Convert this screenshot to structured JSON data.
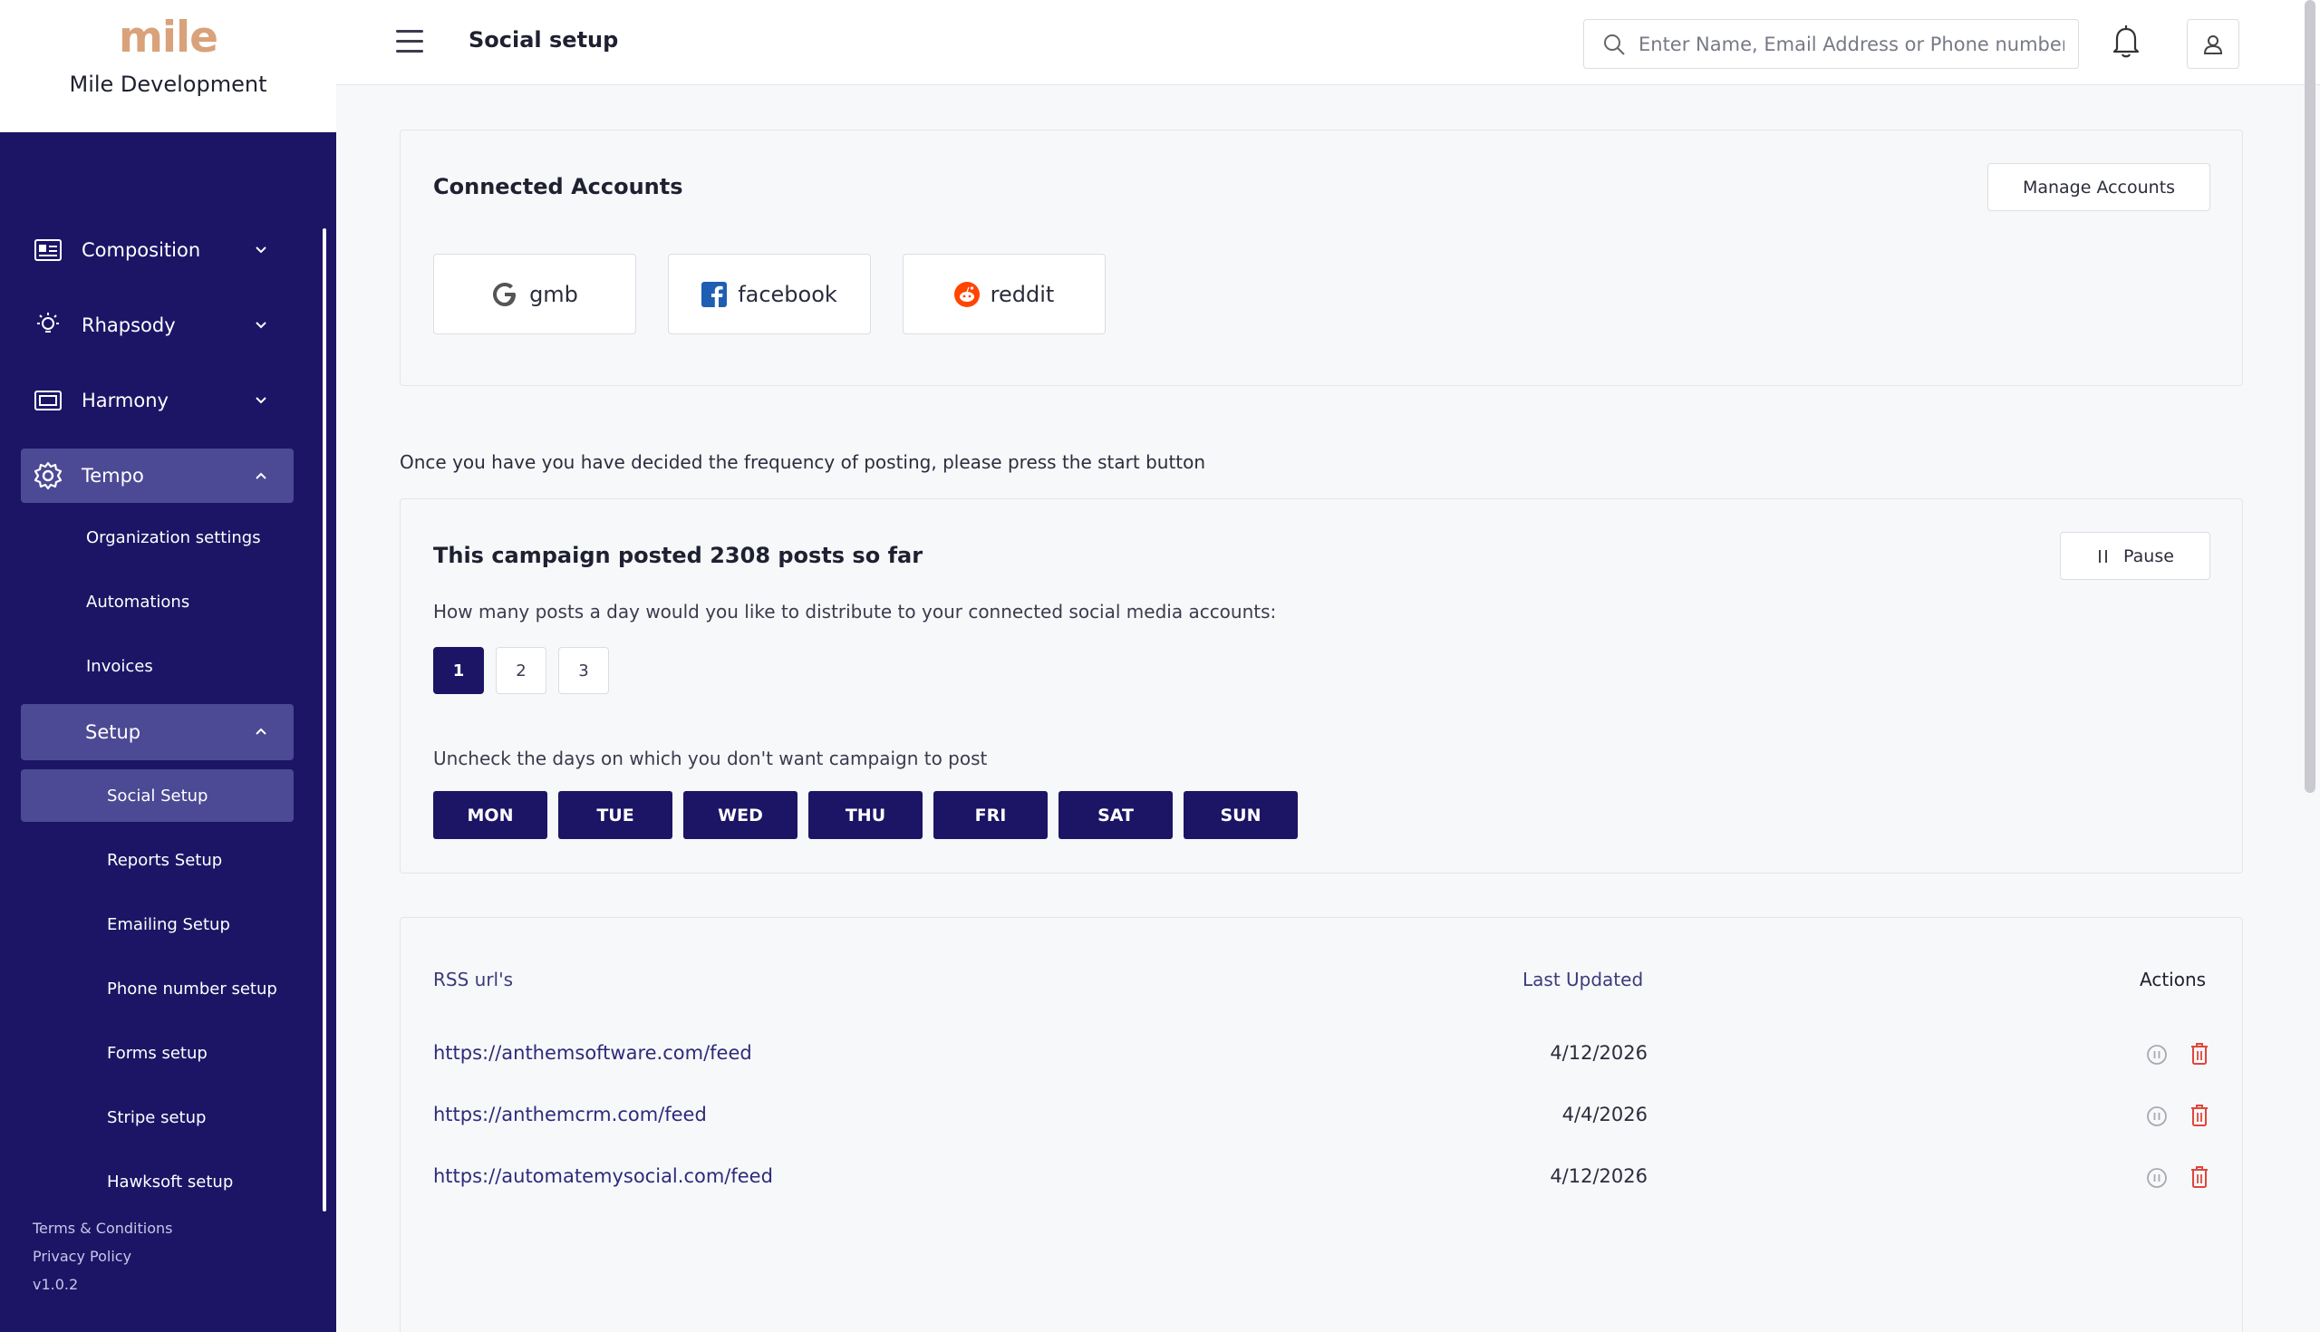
{
  "brand": {
    "logo": "mile",
    "org_name": "Mile Development"
  },
  "sidebar": {
    "items": [
      {
        "label": "Composition",
        "icon": "id-card-icon"
      },
      {
        "label": "Rhapsody",
        "icon": "lightbulb-icon"
      },
      {
        "label": "Harmony",
        "icon": "ticket-icon"
      },
      {
        "label": "Tempo",
        "icon": "gear-icon"
      }
    ],
    "tempo_sub": [
      "Organization settings",
      "Automations",
      "Invoices"
    ],
    "setup_label": "Setup",
    "setup_sub": [
      "Social Setup",
      "Reports Setup",
      "Emailing Setup",
      "Phone number setup",
      "Forms setup",
      "Stripe setup",
      "Hawksoft setup"
    ],
    "footer": {
      "terms": "Terms & Conditions",
      "privacy": "Privacy Policy",
      "version": "v1.0.2"
    }
  },
  "header": {
    "title": "Social setup",
    "search_placeholder": "Enter Name, Email Address or Phone number"
  },
  "connected": {
    "title": "Connected Accounts",
    "manage_label": "Manage Accounts",
    "accounts": [
      "gmb",
      "facebook",
      "reddit"
    ]
  },
  "info_text": "Once you have you have decided the frequency of posting, please press the start button",
  "campaign": {
    "title": "This campaign posted 2308 posts so far",
    "pause_label": "Pause",
    "question": "How many posts a day would you like to distribute to your connected social media accounts:",
    "post_counts": [
      "1",
      "2",
      "3"
    ],
    "selected_count": "1",
    "days_text": "Uncheck the days on which you don't want campaign to post",
    "days": [
      "MON",
      "TUE",
      "WED",
      "THU",
      "FRI",
      "SAT",
      "SUN"
    ]
  },
  "rss": {
    "headers": {
      "url": "RSS url's",
      "updated": "Last Updated",
      "actions": "Actions"
    },
    "rows": [
      {
        "url": "https://anthemsoftware.com/feed",
        "date": "4/12/2026"
      },
      {
        "url": "https://anthemcrm.com/feed",
        "date": "4/4/2026"
      },
      {
        "url": "https://automatemysocial.com/feed",
        "date": "4/12/2026"
      }
    ]
  },
  "colors": {
    "sidebar": "#1c1566",
    "active": "#4c4a94",
    "brand": "#d9a27a",
    "delete": "#e0463c"
  }
}
